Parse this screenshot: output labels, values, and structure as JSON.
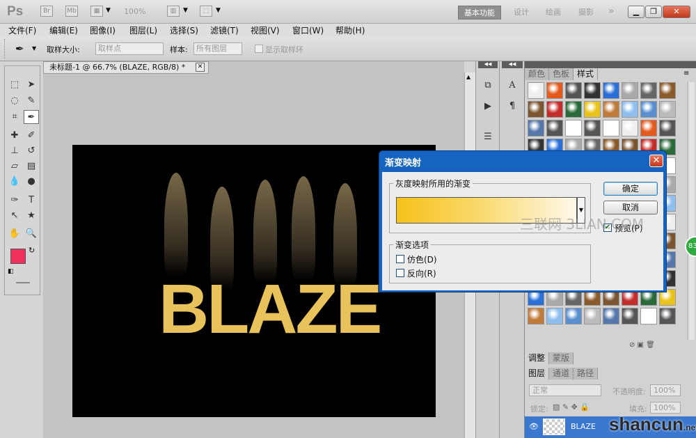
{
  "app": {
    "logo": "Ps",
    "zoom": "100%"
  },
  "workspaces": [
    "基本功能",
    "设计",
    "绘画",
    "摄影"
  ],
  "more": "»",
  "menu": [
    "文件(F)",
    "编辑(E)",
    "图像(I)",
    "图层(L)",
    "选择(S)",
    "滤镜(T)",
    "视图(V)",
    "窗口(W)",
    "帮助(H)"
  ],
  "options": {
    "sample_size_label": "取样大小:",
    "sample_size_value": "取样点",
    "sample_label": "样本:",
    "sample_value": "所有图层",
    "show_ring_label": "显示取样环"
  },
  "document": {
    "tab_title": "未标题-1 @ 66.7% (BLAZE, RGB/8) *",
    "canvas_text": "BLAZE"
  },
  "panels": {
    "styles_tabs": [
      "颜色",
      "色板",
      "样式"
    ],
    "adjust_tabs": [
      "调整",
      "蒙版"
    ],
    "layers_tabs": [
      "图层",
      "通道",
      "路径"
    ],
    "blend_mode": "正常",
    "opacity_label": "不透明度:",
    "opacity_value": "100%",
    "lock_label": "锁定:",
    "fill_label": "填充:",
    "fill_value": "100%",
    "layer_name": "BLAZE"
  },
  "dialog": {
    "title": "渐变映射",
    "group_gradient": "灰度映射所用的渐变",
    "group_options": "渐变选项",
    "dither": "仿色(D)",
    "reverse": "反向(R)",
    "ok": "确定",
    "cancel": "取消",
    "preview": "预览(P)",
    "gradient_start": "#f7c11a",
    "gradient_end": "#fff8ea"
  },
  "watermarks": {
    "sanlian": "三联网 3LIAN.COM",
    "badge": "83",
    "shancun": "shancun",
    "shancun_suffix": ".net"
  },
  "colors": {
    "foreground": "#f0305a",
    "background": "#ffffff",
    "title_bar": "#1565c0",
    "text_fill": "#e8c25a"
  }
}
